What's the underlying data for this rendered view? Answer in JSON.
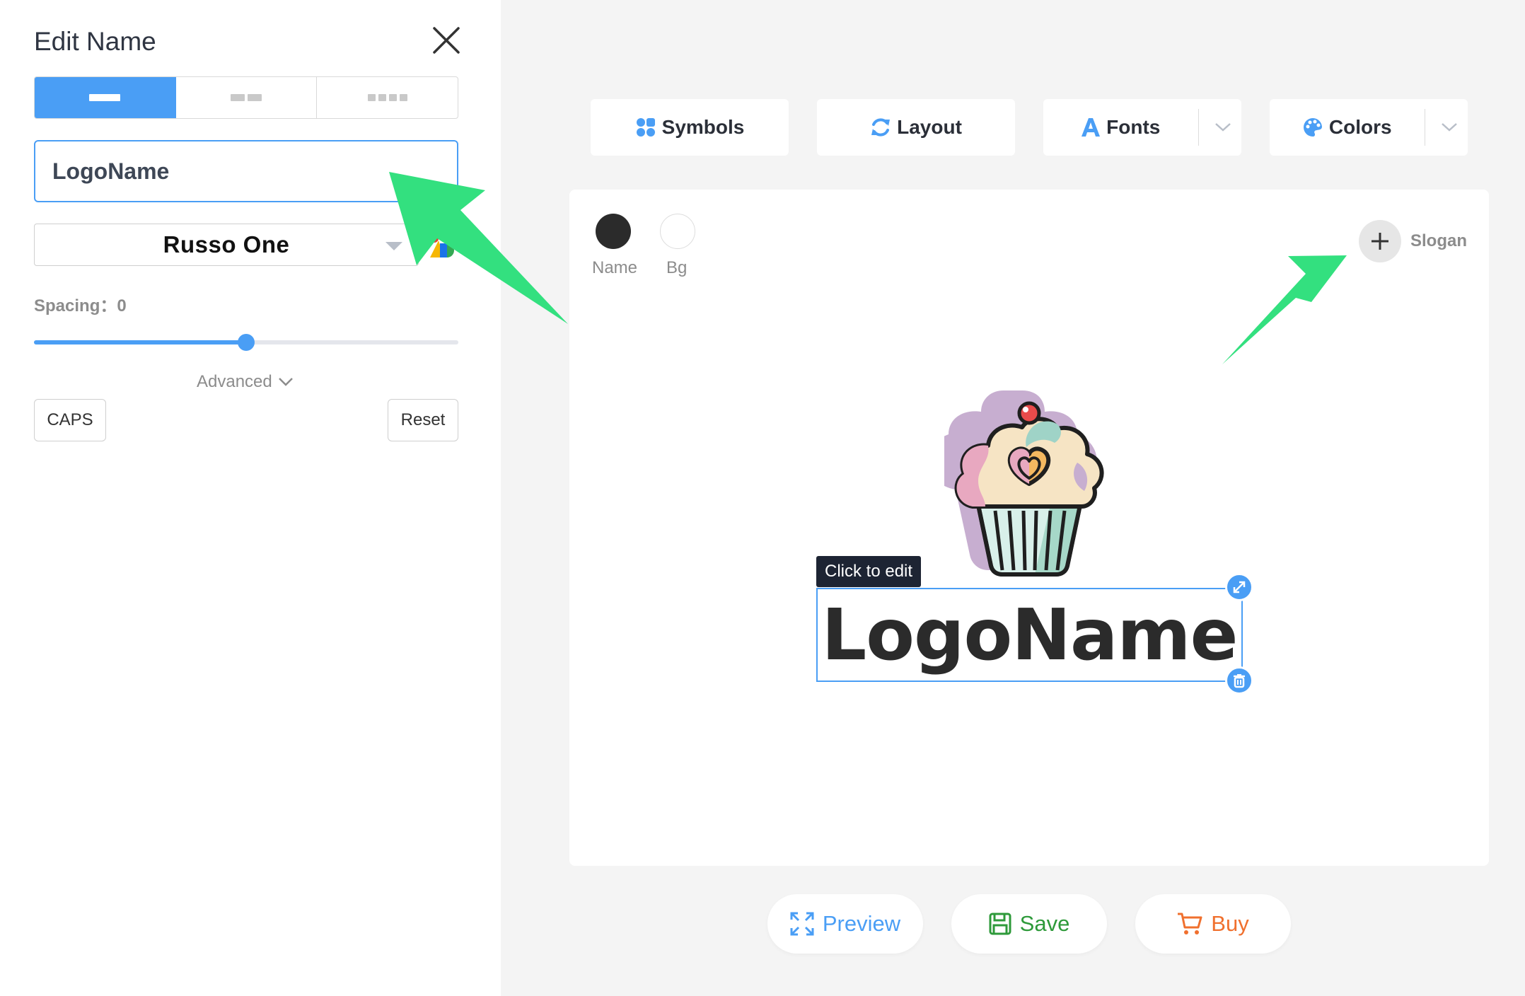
{
  "panel": {
    "title": "Edit Name",
    "layout_options": [
      "single-line",
      "two-words",
      "four-words"
    ],
    "active_layout": 0,
    "name_value": "LogoName",
    "font": "Russo One",
    "spacing_label": "Spacing：0",
    "spacing_fraction": 0.5,
    "advanced_label": "Advanced",
    "caps_label": "CAPS",
    "reset_label": "Reset"
  },
  "toolbar": {
    "symbols_label": "Symbols",
    "layout_label": "Layout",
    "fonts_label": "Fonts",
    "colors_label": "Colors"
  },
  "canvas": {
    "name_swatch_label": "Name",
    "bg_swatch_label": "Bg",
    "name_color": "#2b2b2b",
    "bg_color": "#ffffff",
    "slogan_label": "Slogan",
    "tooltip": "Click to edit",
    "logo_text": "LogoName"
  },
  "actions": {
    "preview_label": "Preview",
    "save_label": "Save",
    "buy_label": "Buy"
  },
  "colors": {
    "accent": "#4a9ef5",
    "save": "#2e9a3a",
    "buy": "#f0702e",
    "arrow": "#33e07f"
  }
}
